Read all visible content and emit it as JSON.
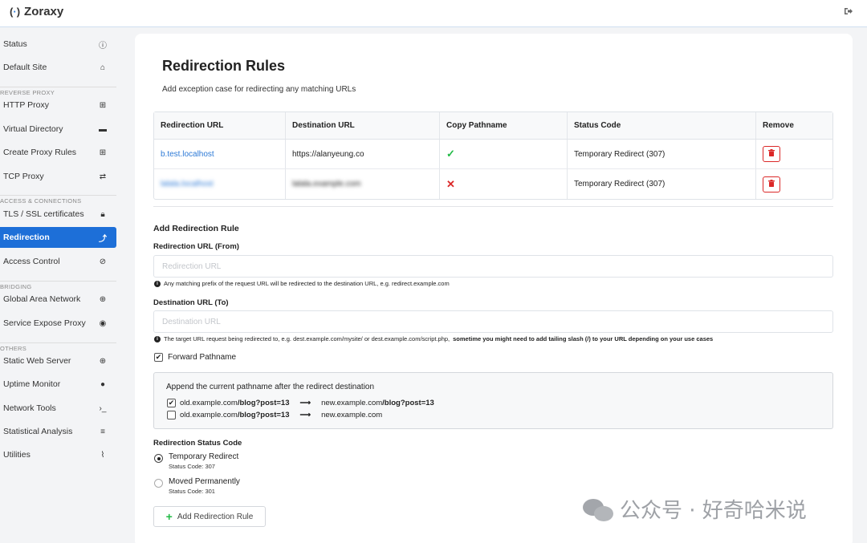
{
  "app": {
    "name": "Zoraxy",
    "logout_icon": "logout-icon"
  },
  "sidebar": {
    "items": [
      {
        "label": "Status",
        "icon": "info-icon"
      },
      {
        "label": "Default Site",
        "icon": "home-icon"
      },
      {
        "label": "HTTP Proxy",
        "icon": "sitemap-icon"
      },
      {
        "label": "Virtual Directory",
        "icon": "folder-icon"
      },
      {
        "label": "Create Proxy Rules",
        "icon": "plus-square-icon"
      },
      {
        "label": "TCP Proxy",
        "icon": "exchange-icon"
      },
      {
        "label": "TLS / SSL certificates",
        "icon": "lock-icon"
      },
      {
        "label": "Redirection",
        "icon": "level-up-icon"
      },
      {
        "label": "Access Control",
        "icon": "ban-icon"
      },
      {
        "label": "Global Area Network",
        "icon": "globe-icon"
      },
      {
        "label": "Service Expose Proxy",
        "icon": "podcast-icon"
      },
      {
        "label": "Static Web Server",
        "icon": "globe-icon"
      },
      {
        "label": "Uptime Monitor",
        "icon": "clock-icon"
      },
      {
        "label": "Network Tools",
        "icon": "terminal-icon"
      },
      {
        "label": "Statistical Analysis",
        "icon": "database-icon"
      },
      {
        "label": "Utilities",
        "icon": "paperclip-icon"
      }
    ],
    "sections": [
      "REVERSE PROXY",
      "ACCESS & CONNECTIONS",
      "BRIDGING",
      "OTHERS"
    ],
    "active": "Redirection"
  },
  "page": {
    "title": "Redirection Rules",
    "subtitle": "Add exception case for redirecting any matching URLs"
  },
  "table": {
    "headers": [
      "Redirection URL",
      "Destination URL",
      "Copy Pathname",
      "Status Code",
      "Remove"
    ],
    "rows": [
      {
        "from": "b.test.localhost",
        "to": "https://alanyeung.co",
        "copy_pathname": true,
        "status": "Temporary Redirect (307)"
      },
      {
        "from": "lalala.localhost",
        "to": "lalala.example.com",
        "copy_pathname": false,
        "status": "Temporary Redirect (307)"
      }
    ]
  },
  "form": {
    "heading": "Add Redirection Rule",
    "from_label": "Redirection URL (From)",
    "from_placeholder": "Redirection URL",
    "from_hint": "Any matching prefix of the request URL will be redirected to the destination URL, e.g. redirect.example.com",
    "to_label": "Destination URL (To)",
    "to_placeholder": "Destination URL",
    "to_hint_a": "The target URL request being redirected to, e.g. dest.example.com/mysite/ or dest.example.com/script.php,",
    "to_hint_b": "sometime you might need to add tailing slash (/) to your URL depending on your use cases",
    "forward_label": "Forward Pathname",
    "forward_checked": true,
    "note_title": "Append the current pathname after the redirect destination",
    "examples": [
      {
        "checked": true,
        "src_host": "old.example.com",
        "src_path": "/blog?post=13",
        "arrow": "⟶",
        "dst_host": "new.example.com",
        "dst_path": "/blog?post=13"
      },
      {
        "checked": false,
        "src_host": "old.example.com",
        "src_path": "/blog?post=13",
        "arrow": "⟶",
        "dst_host": "new.example.com",
        "dst_path": ""
      }
    ],
    "status_label": "Redirection Status Code",
    "options": [
      {
        "label": "Temporary Redirect",
        "sub": "Status Code: 307",
        "selected": true
      },
      {
        "label": "Moved Permanently",
        "sub": "Status Code: 301",
        "selected": false
      }
    ],
    "add_button": "Add Redirection Rule"
  },
  "watermark": {
    "text": "公众号 · 好奇哈米说"
  },
  "colors": {
    "accent": "#1d6fd8",
    "success": "#21ba45",
    "danger": "#db2828",
    "link": "#2d7ad6"
  }
}
